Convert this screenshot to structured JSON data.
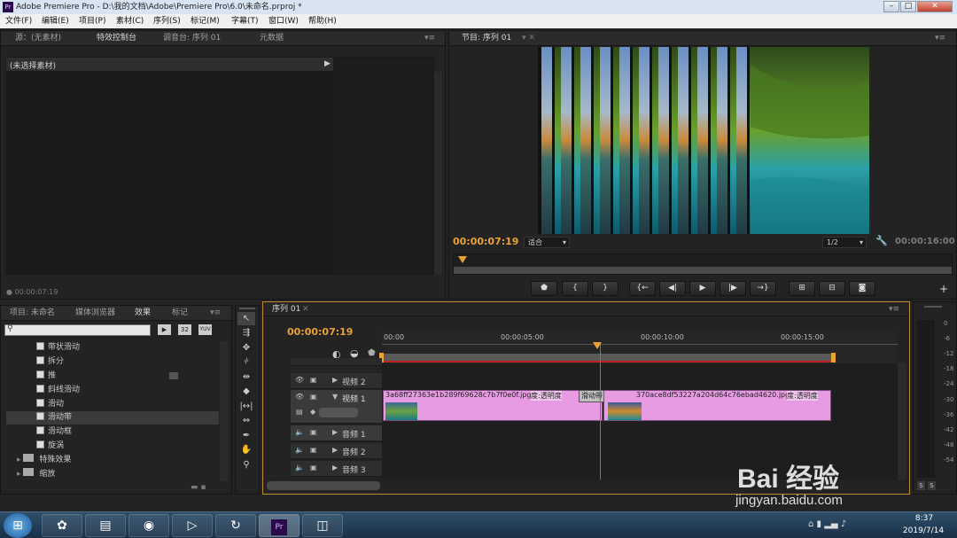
{
  "window": {
    "title": "Adobe Premiere Pro - D:\\我的文档\\Adobe\\Premiere Pro\\6.0\\未命名.prproj *",
    "app_icon": "Pr"
  },
  "menu": [
    "文件(F)",
    "编辑(E)",
    "项目(P)",
    "素材(C)",
    "序列(S)",
    "标记(M)",
    "字幕(T)",
    "窗口(W)",
    "帮助(H)"
  ],
  "source_panel": {
    "tabs": [
      "源：(无素材)",
      "特效控制台",
      "调音台: 序列 01",
      "元数据"
    ],
    "header": "(未选择素材)",
    "timecode": "00:00:07:19"
  },
  "program_panel": {
    "tab": "节目: 序列 01",
    "current_time": "00:00:07:19",
    "fit": "适合",
    "resolution": "1/2",
    "duration": "00:00:16:00"
  },
  "project_panel": {
    "tabs": [
      "项目: 未命名",
      "媒体浏览器",
      "效果",
      "标记"
    ],
    "items": [
      "带状滑动",
      "拆分",
      "推",
      "斜线滑动",
      "滑动",
      "滑动带",
      "滑动框",
      "旋涡"
    ],
    "selected": "滑动带",
    "folders": [
      "特殊效果",
      "缩放"
    ],
    "badges": [
      "32",
      "YUV"
    ]
  },
  "timeline": {
    "tab": "序列 01",
    "timecode": "00:00:07:19",
    "ruler": [
      "00:00",
      "00:00:05:00",
      "00:00:10:00",
      "00:00:15:00"
    ],
    "tracks": [
      {
        "name": "视频 2"
      },
      {
        "name": "视频 1"
      },
      {
        "name": "音频 1"
      },
      {
        "name": "音频 2"
      },
      {
        "name": "音频 3"
      }
    ],
    "clip1": {
      "name": "3a68ff27363e1b289f69628c7b7f0e0f.jpg",
      "fx": "度:透明度"
    },
    "transition": "滑动带",
    "clip2": {
      "name": "370ace8df53227a204d64c76ebad4620.jpg",
      "fx": "度:透明度"
    }
  },
  "audio_meter": {
    "scale": [
      "0",
      "-6",
      "-12",
      "-18",
      "-24",
      "-30",
      "-36",
      "-42",
      "-48",
      "-54"
    ],
    "solo": [
      "S",
      "S"
    ]
  },
  "watermark": "Bai 经验",
  "watermark_url": "jingyan.baidu.com",
  "taskbar": {
    "time": "8:37",
    "date": "2019/7/14"
  }
}
